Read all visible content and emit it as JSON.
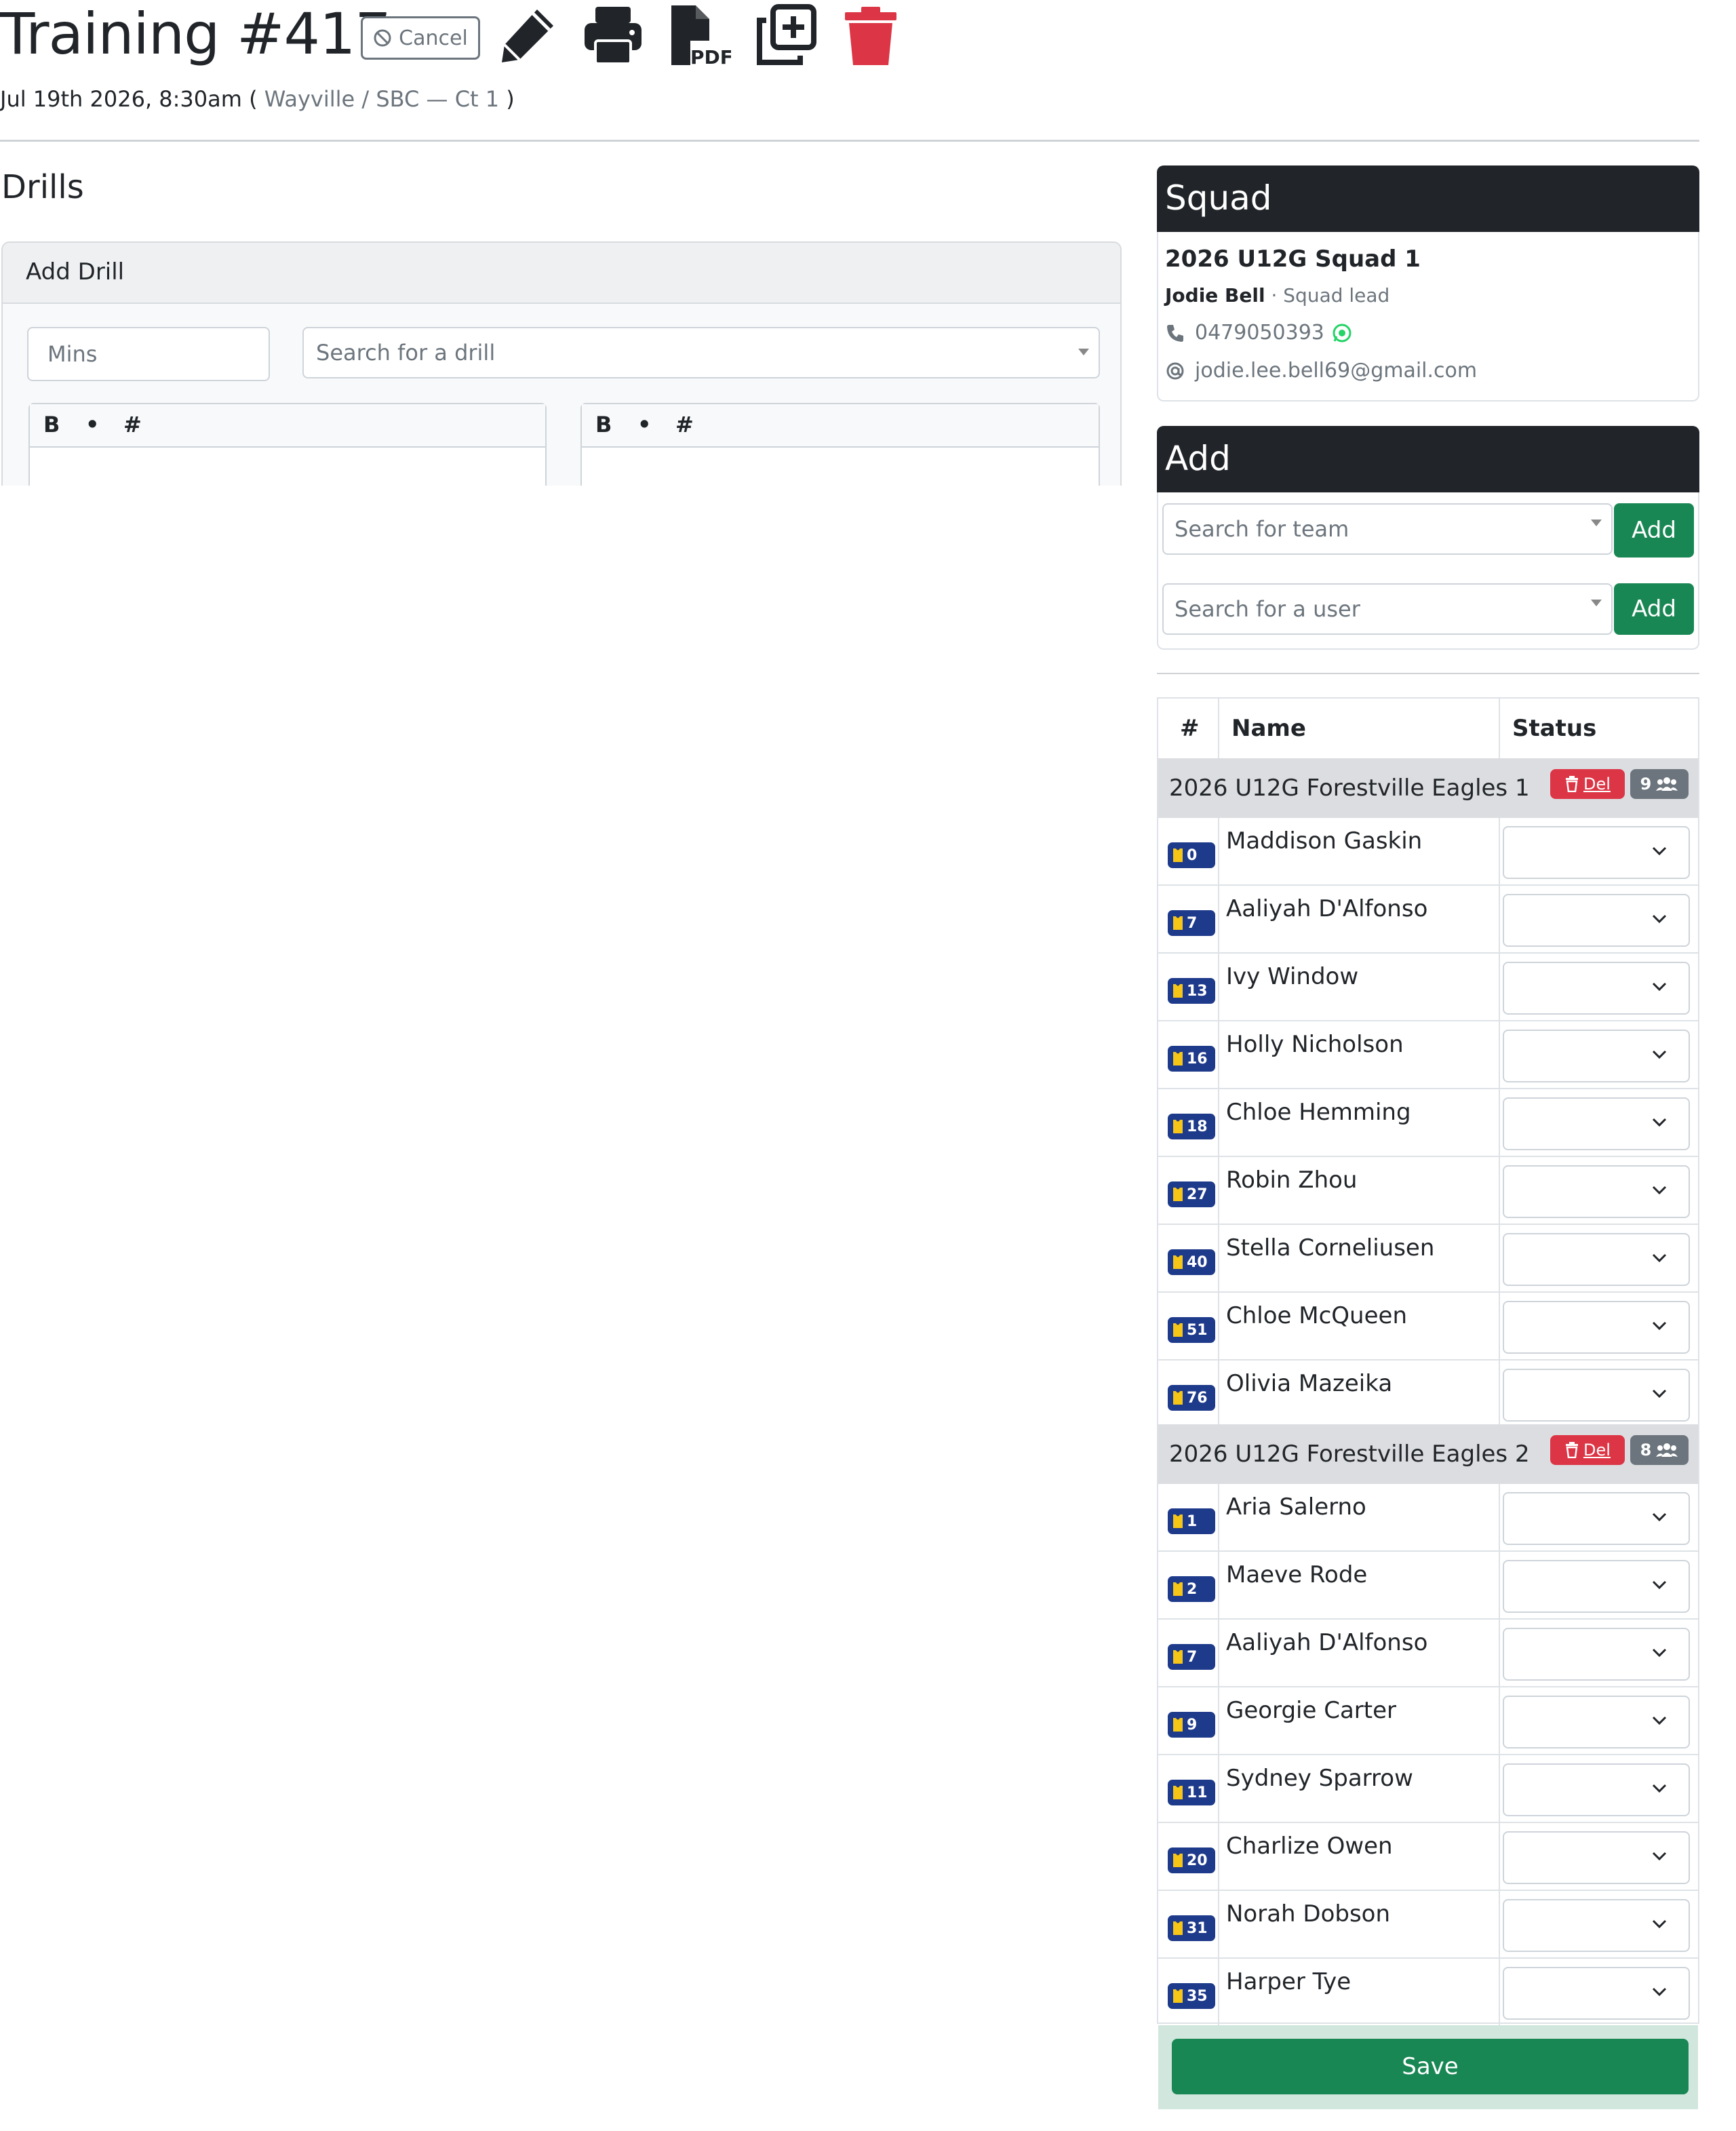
{
  "header": {
    "title": "Training #417",
    "cancel_label": "Cancel",
    "datetime": "Jul 19th 2026, 8:30am (",
    "venue": "Wayville / SBC — Ct 1",
    "close_paren": ")",
    "icons": [
      "pencil-icon",
      "printer-icon",
      "file-pdf-icon",
      "copy-plus-icon",
      "trash-icon"
    ],
    "accent_danger": "#dc3545"
  },
  "drills": {
    "heading": "Drills",
    "card_title": "Add Drill",
    "mins_placeholder": "Mins",
    "search_placeholder": "Search for a drill",
    "editor_left": {
      "bold": "B",
      "bullet": "•",
      "hash": "#"
    },
    "editor_right": {
      "bold": "B",
      "bullet": "•",
      "hash": "#"
    }
  },
  "squad": {
    "heading": "Squad",
    "name": "2026 U12G Squad 1",
    "lead_name": "Jodie Bell",
    "lead_role": "· Squad lead",
    "phone": "0479050393",
    "email": "jodie.lee.bell69@gmail.com"
  },
  "add": {
    "heading": "Add",
    "team_placeholder": "Search for team",
    "user_placeholder": "Search for a user",
    "add_label": "Add",
    "add_label_2": "Add"
  },
  "table": {
    "col_num": "#",
    "col_name": "Name",
    "col_status": "Status",
    "groups": [
      {
        "name": "2026 U12G Forestville Eagles 1",
        "del_label": "Del",
        "count": "9",
        "players": [
          {
            "num": "0",
            "name": "Maddison Gaskin"
          },
          {
            "num": "7",
            "name": "Aaliyah D'Alfonso"
          },
          {
            "num": "13",
            "name": "Ivy Window"
          },
          {
            "num": "16",
            "name": "Holly Nicholson"
          },
          {
            "num": "18",
            "name": "Chloe Hemming"
          },
          {
            "num": "27",
            "name": "Robin Zhou"
          },
          {
            "num": "40",
            "name": "Stella Corneliusen"
          },
          {
            "num": "51",
            "name": "Chloe McQueen"
          },
          {
            "num": "76",
            "name": "Olivia Mazeika"
          }
        ]
      },
      {
        "name": "2026 U12G Forestville Eagles 2",
        "del_label": "Del",
        "count": "8",
        "players": [
          {
            "num": "1",
            "name": "Aria Salerno"
          },
          {
            "num": "2",
            "name": "Maeve Rode"
          },
          {
            "num": "7",
            "name": "Aaliyah D'Alfonso"
          },
          {
            "num": "9",
            "name": "Georgie Carter"
          },
          {
            "num": "11",
            "name": "Sydney Sparrow"
          },
          {
            "num": "20",
            "name": "Charlize Owen"
          },
          {
            "num": "31",
            "name": "Norah Dobson"
          },
          {
            "num": "35",
            "name": "Harper Tye"
          }
        ]
      }
    ]
  },
  "save_label": "Save",
  "colors": {
    "dark": "#212529",
    "success": "#198754",
    "danger": "#dc3545",
    "secondary": "#6c757d",
    "bib_bg": "#1e3a8a",
    "bib_icon": "#f5c518"
  }
}
